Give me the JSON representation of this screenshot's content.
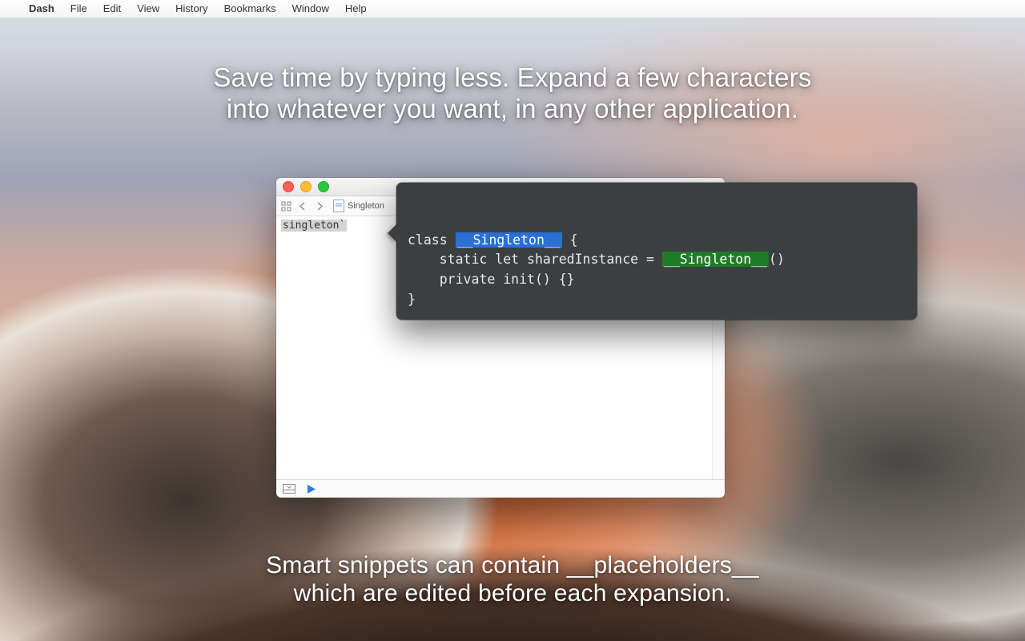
{
  "menubar": {
    "apple_glyph": "",
    "appname": "Dash",
    "items": [
      "File",
      "Edit",
      "View",
      "History",
      "Bookmarks",
      "Window",
      "Help"
    ]
  },
  "caption_top_l1": "Save time by typing less. Expand a few characters",
  "caption_top_l2": "into whatever you want, in any other application.",
  "caption_bottom_l1": "Smart snippets can contain __placeholders__",
  "caption_bottom_l2": "which are edited before each expansion.",
  "editor": {
    "tab_label": "Singleton",
    "typed_text": "singleton`"
  },
  "snippet": {
    "line1_a": "class ",
    "line1_hl": "__Singleton__",
    "line1_b": " {",
    "line2_a": "    static let sharedInstance = ",
    "line2_hl": "__Singleton__",
    "line2_b": "()",
    "line3": "    private init() {}",
    "line4": "}"
  }
}
